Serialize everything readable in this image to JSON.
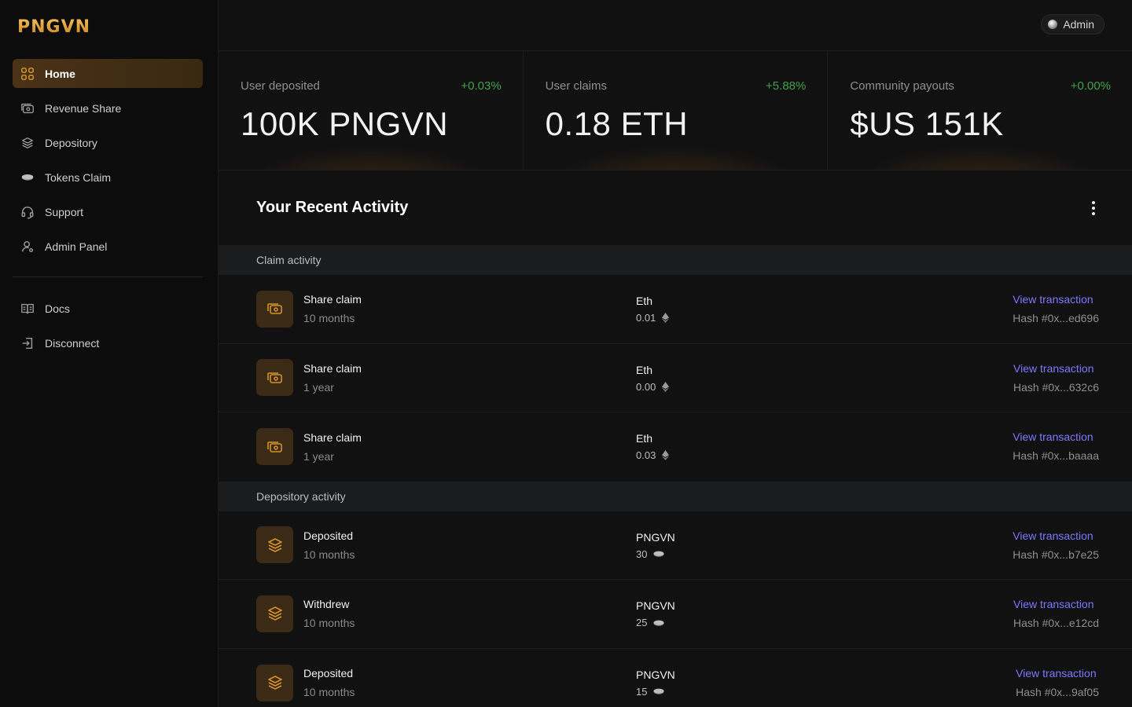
{
  "brand": {
    "logo_text": "PNGVN",
    "accent": "#d99a2b",
    "link_color": "#7f77ff",
    "positive_color": "#3fa24a"
  },
  "sidebar": {
    "items": [
      {
        "label": "Home",
        "icon": "grid-icon",
        "active": true
      },
      {
        "label": "Revenue Share",
        "icon": "cash-icon"
      },
      {
        "label": "Depository",
        "icon": "layers-icon"
      },
      {
        "label": "Tokens Claim",
        "icon": "coin-icon"
      },
      {
        "label": "Support",
        "icon": "headset-icon"
      },
      {
        "label": "Admin Panel",
        "icon": "user-icon"
      }
    ],
    "bottom_items": [
      {
        "label": "Docs",
        "icon": "book-icon"
      },
      {
        "label": "Disconnect",
        "icon": "logout-icon"
      }
    ]
  },
  "topbar": {
    "admin_label": "Admin"
  },
  "stats": [
    {
      "label": "User deposited",
      "change": "+0.03%",
      "value": "100K PNGVN"
    },
    {
      "label": "User claims",
      "change": "+5.88%",
      "value": "0.18 ETH"
    },
    {
      "label": "Community payouts",
      "change": "+0.00%",
      "value": "$US 151K"
    }
  ],
  "activity": {
    "title": "Your Recent Activity",
    "claim_section": "Claim activity",
    "depository_section": "Depository activity",
    "view_label": "View transaction",
    "claims": [
      {
        "title": "Share claim",
        "time": "10 months",
        "asset": "Eth",
        "amount": "0.01",
        "hash": "Hash #0x...ed696"
      },
      {
        "title": "Share claim",
        "time": "1 year",
        "asset": "Eth",
        "amount": "0.00",
        "hash": "Hash #0x...632c6"
      },
      {
        "title": "Share claim",
        "time": "1 year",
        "asset": "Eth",
        "amount": "0.03",
        "hash": "Hash #0x...baaaa"
      }
    ],
    "deposits": [
      {
        "title": "Deposited",
        "time": "10 months",
        "asset": "PNGVN",
        "amount": "30",
        "hash": "Hash #0x...b7e25"
      },
      {
        "title": "Withdrew",
        "time": "10 months",
        "asset": "PNGVN",
        "amount": "25",
        "hash": "Hash #0x...e12cd"
      },
      {
        "title": "Deposited",
        "time": "10 months",
        "asset": "PNGVN",
        "amount": "15",
        "hash": "Hash #0x...9af05"
      }
    ]
  }
}
